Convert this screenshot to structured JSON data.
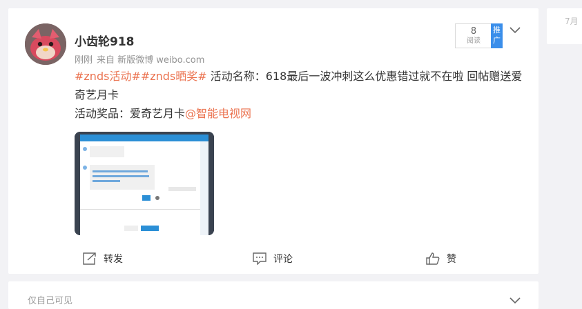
{
  "post": {
    "author": "小齿轮918",
    "time": "刚刚",
    "source": "来自 新版微博 weibo.com",
    "read_count": "8",
    "read_label": "阅读",
    "promote_label": "推广",
    "tags": "#znds活动##znds晒奖#",
    "line1_rest": " 活动名称：618最后一波冲刺这么优惠错过就不在啦 回帖赠送爱奇艺月卡",
    "line2_prefix": "活动奖品：爱奇艺月卡",
    "mention": "@智能电视网",
    "image_alt": "ZNDS聊天截图"
  },
  "actions": {
    "repost": "转发",
    "comment": "评论",
    "like": "赞"
  },
  "next_card": {
    "visibility": "仅自己可见"
  },
  "sidebar": {
    "date": "7月"
  },
  "icons": {
    "repost": "repost-icon",
    "comment": "comment-icon",
    "like": "thumbs-up-icon",
    "menu": "chevron-down-icon"
  },
  "colors": {
    "accent": "#eb7350",
    "promote": "#3a8eea"
  }
}
